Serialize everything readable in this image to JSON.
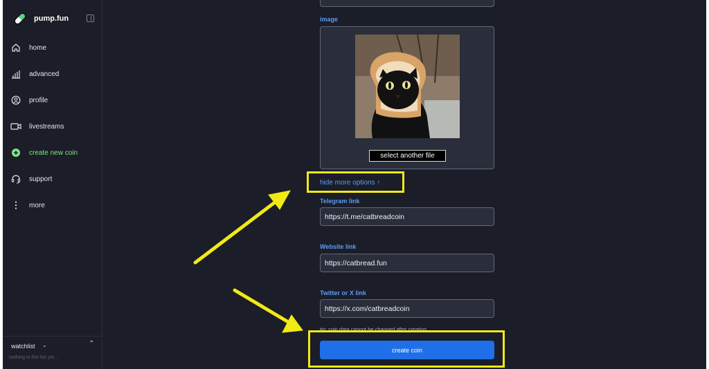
{
  "sidebar": {
    "brand": "pump.fun",
    "items": [
      {
        "label": "home",
        "icon": "home-icon"
      },
      {
        "label": "advanced",
        "icon": "bar-chart-icon"
      },
      {
        "label": "profile",
        "icon": "user-circle-icon"
      },
      {
        "label": "livestreams",
        "icon": "video-camera-icon"
      },
      {
        "label": "create new coin",
        "icon": "plus-circle-icon"
      },
      {
        "label": "support",
        "icon": "headset-icon"
      },
      {
        "label": "more",
        "icon": "vertical-dots-icon"
      }
    ],
    "watchlist": {
      "title": "watchlist",
      "empty": "nothing in this list yet..."
    }
  },
  "form": {
    "image_label": "image",
    "select_file": "select another file",
    "more_options": "hide more options ↑",
    "telegram": {
      "label": "Telegram link",
      "value": "https://t.me/catbreadcoin"
    },
    "website": {
      "label": "Website link",
      "value": "https://catbread.fun"
    },
    "twitter": {
      "label": "Twitter or X link",
      "value": "https://x.com/catbreadcoin"
    },
    "tip": "tip: coin data cannot be changed after creation",
    "create": "create coin"
  },
  "colors": {
    "accent": "#1f6fe8",
    "label_blue": "#5b9cf5",
    "highlight": "#f2ea15",
    "new_coin_green": "#7ee787"
  }
}
